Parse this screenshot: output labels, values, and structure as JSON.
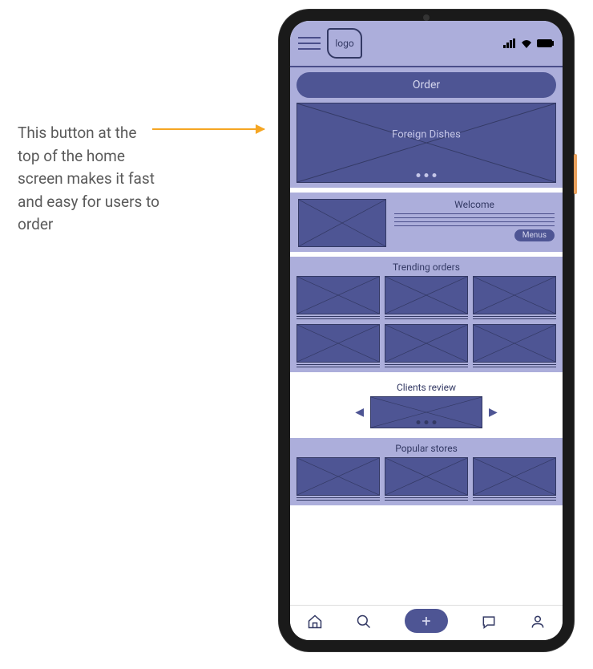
{
  "annotation": "This button at the top of the home screen makes it fast and easy for users to order",
  "header": {
    "logo_text": "logo"
  },
  "order_button_label": "Order",
  "hero": {
    "label": "Foreign Dishes"
  },
  "welcome": {
    "title": "Welcome",
    "menus_button": "Menus"
  },
  "sections": {
    "trending_title": "Trending orders",
    "reviews_title": "Clients review",
    "popular_title": "Popular stores"
  },
  "nav": {
    "add_label": "+"
  }
}
